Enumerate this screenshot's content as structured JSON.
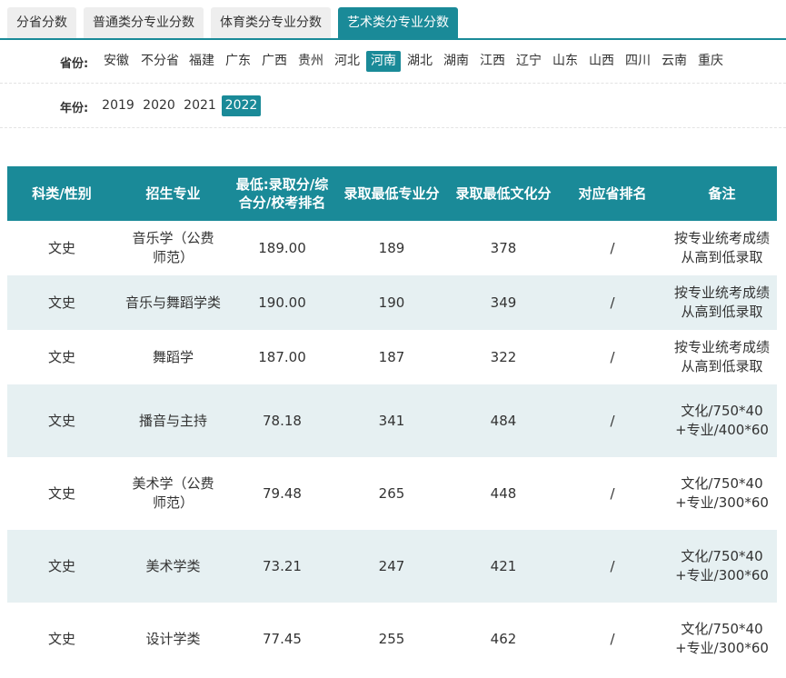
{
  "tabs": [
    {
      "label": "分省分数",
      "active": false
    },
    {
      "label": "普通类分专业分数",
      "active": false
    },
    {
      "label": "体育类分专业分数",
      "active": false
    },
    {
      "label": "艺术类分专业分数",
      "active": true
    }
  ],
  "province_filter": {
    "label": "省份:",
    "options": [
      "安徽",
      "不分省",
      "福建",
      "广东",
      "广西",
      "贵州",
      "河北",
      "河南",
      "湖北",
      "湖南",
      "江西",
      "辽宁",
      "山东",
      "山西",
      "四川",
      "云南",
      "重庆"
    ],
    "selected": "河南"
  },
  "year_filter": {
    "label": "年份:",
    "options": [
      "2019",
      "2020",
      "2021",
      "2022"
    ],
    "selected": "2022"
  },
  "table": {
    "headers": [
      "科类/性别",
      "招生专业",
      "最低:录取分/综合分/校考排名",
      "录取最低专业分",
      "录取最低文化分",
      "对应省排名",
      "备注"
    ],
    "rows": [
      [
        "文史",
        "音乐学（公费师范）",
        "189.00",
        "189",
        "378",
        "/",
        "按专业统考成绩从高到低录取"
      ],
      [
        "文史",
        "音乐与舞蹈学类",
        "190.00",
        "190",
        "349",
        "/",
        "按专业统考成绩从高到低录取"
      ],
      [
        "文史",
        "舞蹈学",
        "187.00",
        "187",
        "322",
        "/",
        "按专业统考成绩从高到低录取"
      ],
      [
        "文史",
        "播音与主持",
        "78.18",
        "341",
        "484",
        "/",
        "文化/750*40+专业/400*60"
      ],
      [
        "文史",
        "美术学（公费师范）",
        "79.48",
        "265",
        "448",
        "/",
        "文化/750*40+专业/300*60"
      ],
      [
        "文史",
        "美术学类",
        "73.21",
        "247",
        "421",
        "/",
        "文化/750*40+专业/300*60"
      ],
      [
        "文史",
        "设计学类",
        "77.45",
        "255",
        "462",
        "/",
        "文化/750*40+专业/300*60"
      ]
    ]
  }
}
